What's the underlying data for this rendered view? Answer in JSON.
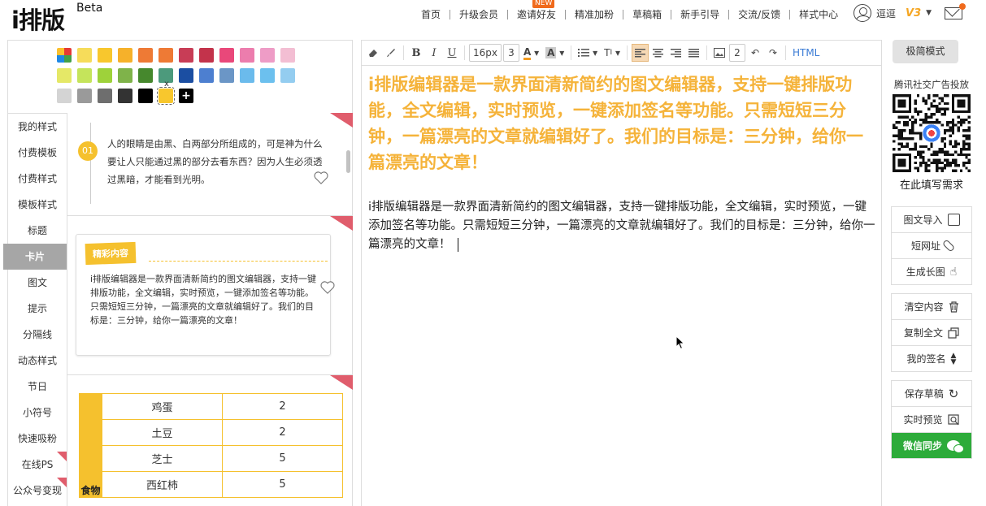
{
  "header": {
    "logo_main": "i排版",
    "logo_beta": "Beta",
    "nav": [
      {
        "label": "首页"
      },
      {
        "label": "升级会员"
      },
      {
        "label": "邀请好友",
        "badge": "NEW"
      },
      {
        "label": "精准加粉"
      },
      {
        "label": "草稿箱"
      },
      {
        "label": "新手引导"
      },
      {
        "label": "交流/反馈"
      },
      {
        "label": "样式中心"
      }
    ],
    "username": "逗逗",
    "vip_level": "V3"
  },
  "palette": {
    "rows": [
      [
        "rainbow",
        "#f6dc5a",
        "#f8c72d",
        "#f6b12a",
        "#ee7a35",
        "#ee7a35",
        "#c83d56",
        "#c3334b",
        "#e9487a",
        "#ec7dad",
        "#ee9cc6",
        "#f3bed3"
      ],
      [
        "#e5e867",
        "#c5e45b",
        "#9ed23a",
        "#7fb34a",
        "#46882d",
        "#4c9a7c",
        "#1b4ea2",
        "#4d7fd0",
        "#6b96c6",
        "#6bbbec",
        "#6cc0ee",
        "#94cdf0"
      ],
      [
        "#d4d4d4",
        "#9a9a9a",
        "#6e6e6e",
        "#333333",
        "#000000",
        "#f8c72d",
        "plus"
      ]
    ],
    "selected_marker": "x"
  },
  "side_nav": [
    {
      "label": "我的样式"
    },
    {
      "label": "付费模板"
    },
    {
      "label": "付费样式"
    },
    {
      "label": "模板样式"
    },
    {
      "label": "标题"
    },
    {
      "label": "卡片",
      "active": true
    },
    {
      "label": "图文"
    },
    {
      "label": "提示"
    },
    {
      "label": "分隔线"
    },
    {
      "label": "动态样式"
    },
    {
      "label": "节日"
    },
    {
      "label": "小符号"
    },
    {
      "label": "快速吸粉"
    },
    {
      "label": "在线PS",
      "corner": true
    },
    {
      "label": "公众号变现",
      "corner": true
    }
  ],
  "templates": {
    "t1": {
      "number": "01",
      "text": "人的眼睛是由黑、白两部分所组成的，可是神为什么要让人只能通过黑的部分去看东西？因为人生必须透过黑暗，才能看到光明。"
    },
    "t2": {
      "label": "精彩内容",
      "text": "i排版编辑器是一款界面清新简约的图文编辑器，支持一键排版功能，全文编辑，实时预览，一键添加签名等功能。只需短短三分钟，一篇漂亮的文章就编辑好了。我们的目标是：三分钟，给你一篇漂亮的文章！"
    },
    "t3": {
      "header": "食物",
      "rows": [
        {
          "name": "鸡蛋",
          "qty": "2"
        },
        {
          "name": "土豆",
          "qty": "2"
        },
        {
          "name": "芝士",
          "qty": "5"
        },
        {
          "name": "西红柿",
          "qty": "5"
        }
      ]
    }
  },
  "toolbar": {
    "font_size": "16px",
    "line_height": "3",
    "image_count": "2",
    "html_label": "HTML",
    "text_color": "#f29b20"
  },
  "editor": {
    "heading": "i排版编辑器是一款界面清新简约的图文编辑器，支持一键排版功能，全文编辑，实时预览，一键添加签名等功能。只需短短三分钟，一篇漂亮的文章就编辑好了。我们的目标是：三分钟，给你一篇漂亮的文章！",
    "body": "i排版编辑器是一款界面清新简约的图文编辑器，支持一键排版功能，全文编辑，实时预览，一键添加签名等功能。只需短短三分钟，一篇漂亮的文章就编辑好了。我们的目标是：三分钟，给你一篇漂亮的文章！",
    "heading_color": "#f5b33a"
  },
  "right_panel": {
    "simple_mode": "极简模式",
    "ad_title": "腾讯社交广告投放",
    "qr_caption": "在此填写需求",
    "group1": [
      {
        "label": "图文导入",
        "icon": "import-icon"
      },
      {
        "label": "短网址",
        "icon": "link-icon"
      },
      {
        "label": "生成长图",
        "icon": "hand-icon"
      }
    ],
    "group2": [
      {
        "label": "清空内容",
        "icon": "trash-icon"
      },
      {
        "label": "复制全文",
        "icon": "copy-icon"
      },
      {
        "label": "我的签名",
        "icon": "sort-icon"
      }
    ],
    "group3": [
      {
        "label": "保存草稿",
        "icon": "refresh-icon"
      },
      {
        "label": "实时预览",
        "icon": "preview-icon"
      },
      {
        "label": "微信同步",
        "icon": "wechat-icon"
      }
    ],
    "wechat_color": "#2dab3a"
  }
}
